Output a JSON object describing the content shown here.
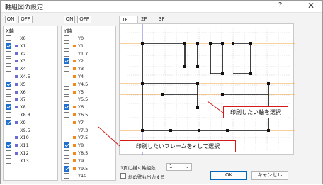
{
  "window": {
    "title": "軸組図の設定",
    "help": "?",
    "close": "✕"
  },
  "x_panel": {
    "on_label": "ON",
    "off_label": "OFF",
    "header": "X軸",
    "items": [
      {
        "label": "X0",
        "checked": false,
        "color": ""
      },
      {
        "label": "X1",
        "checked": true,
        "color": "#6b6bd6"
      },
      {
        "label": "X2",
        "checked": false,
        "color": "#6b6bd6"
      },
      {
        "label": "X3",
        "checked": false,
        "color": "#6b6bd6"
      },
      {
        "label": "X4",
        "checked": false,
        "color": "#6b6bd6"
      },
      {
        "label": "X4.5",
        "checked": false,
        "color": "#6b6bd6"
      },
      {
        "label": "X5",
        "checked": true,
        "color": "#6b6bd6"
      },
      {
        "label": "X6",
        "checked": false,
        "color": "#6b6bd6"
      },
      {
        "label": "X7",
        "checked": false,
        "color": "#6b6bd6"
      },
      {
        "label": "X8",
        "checked": true,
        "color": "#6b6bd6"
      },
      {
        "label": "X8.8",
        "checked": false,
        "color": ""
      },
      {
        "label": "X9",
        "checked": true,
        "color": "#6b6bd6"
      },
      {
        "label": "X9.5",
        "checked": false,
        "color": ""
      },
      {
        "label": "X10",
        "checked": false,
        "color": "#6b6bd6"
      },
      {
        "label": "X11",
        "checked": true,
        "color": "#6b6bd6"
      },
      {
        "label": "X12",
        "checked": false,
        "color": "#6b6bd6"
      },
      {
        "label": "X13",
        "checked": false,
        "color": ""
      }
    ]
  },
  "y_panel": {
    "on_label": "ON",
    "off_label": "OFF",
    "header": "Y軸",
    "items": [
      {
        "label": "Y0",
        "checked": false,
        "color": ""
      },
      {
        "label": "Y1",
        "checked": false,
        "color": "#f08a1e"
      },
      {
        "label": "Y1.7",
        "checked": false,
        "color": ""
      },
      {
        "label": "Y2",
        "checked": true,
        "color": "#f08a1e"
      },
      {
        "label": "Y3",
        "checked": false,
        "color": "#f08a1e"
      },
      {
        "label": "Y4",
        "checked": false,
        "color": "#f08a1e"
      },
      {
        "label": "Y4.5",
        "checked": false,
        "color": "#f08a1e"
      },
      {
        "label": "Y5",
        "checked": false,
        "color": "#f08a1e"
      },
      {
        "label": "Y5.5",
        "checked": false,
        "color": ""
      },
      {
        "label": "Y6",
        "checked": true,
        "color": "#f08a1e"
      },
      {
        "label": "Y6.5",
        "checked": false,
        "color": "#f08a1e"
      },
      {
        "label": "Y7",
        "checked": false,
        "color": "#f08a1e"
      },
      {
        "label": "Y7.3",
        "checked": false,
        "color": ""
      },
      {
        "label": "Y7.5",
        "checked": false,
        "color": "#f08a1e"
      },
      {
        "label": "Y8",
        "checked": true,
        "color": "#f08a1e"
      },
      {
        "label": "Y8.5",
        "checked": false,
        "color": "#f08a1e"
      },
      {
        "label": "Y9",
        "checked": false,
        "color": "#f08a1e"
      },
      {
        "label": "Y9.5",
        "checked": true,
        "color": "#f08a1e"
      },
      {
        "label": "Y10",
        "checked": false,
        "color": ""
      }
    ]
  },
  "tabs": [
    {
      "label": "1F",
      "active": true
    },
    {
      "label": "2F",
      "active": false
    },
    {
      "label": "3F",
      "active": false
    }
  ],
  "callouts": {
    "axis": "印刷したい軸を選択",
    "frame": "印刷したいフレームを✔して選択"
  },
  "footer": {
    "per_page_label": "1頁に描く軸組数",
    "per_page_value": "1",
    "slant_wall_label": "斜め壁も出力する",
    "ok_label": "OK",
    "cancel_label": "キャンセル"
  },
  "colors": {
    "x_axis": "#6b6bd6",
    "y_axis": "#f08a1e",
    "callout_border": "#d31a1a",
    "check": "#1f6fd0"
  }
}
